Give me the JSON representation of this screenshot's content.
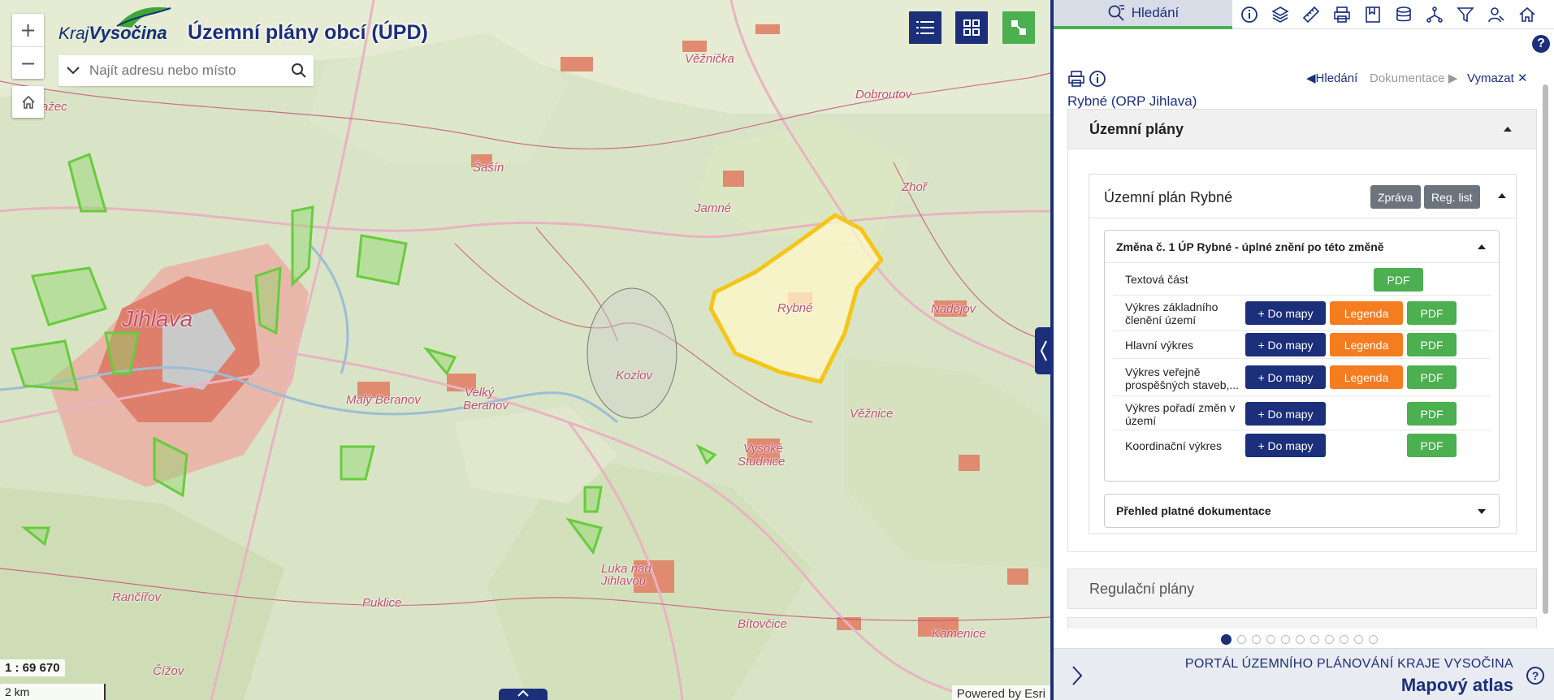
{
  "map": {
    "title": "Územní plány obcí (ÚPD)",
    "logo": {
      "kraj": "Kraj",
      "name": "Vysočina"
    },
    "search": {
      "placeholder": "Najít adresu nebo místo"
    },
    "zoom": {
      "in": "+",
      "out": "−"
    },
    "scale": "1 : 69 670",
    "scale_bar": "2 km",
    "attribution": "Powered by Esri",
    "labels": {
      "jihlava": "Jihlava",
      "rybne": "Rybné",
      "kozlov": "Kozlov",
      "maly_beranov": "Malý Beranov",
      "velky_beranov_1": "Velký",
      "velky_beranov_2": "Beranov",
      "jamne": "Jamné",
      "dobroutov": "Dobroutov",
      "nadejov": "Nadějov",
      "vezice": "Věžnice",
      "vysoke_studnice_1": "Vysoké",
      "vysoke_studnice_2": "Studnice",
      "zhor": "Zhoř",
      "rancirov": "Rančířov",
      "cizov": "Čížov",
      "bitovcice": "Bítovčice",
      "kamenice": "Kamenice",
      "pukov": "Puklice",
      "luka_1": "Luka nad",
      "luka_2": "Jihlavou",
      "vezicka": "Věžnička",
      "sasin": "Šašín",
      "pravlec": "Pražec"
    },
    "colors": {
      "boundary": "#f5c518",
      "brand": "#1b2f7a",
      "accent_green": "#4caf50"
    }
  },
  "panel": {
    "search_tab": "Hledání",
    "nav": {
      "back": "Hledání",
      "forward": "Dokumentace",
      "clear": "Vymazat"
    },
    "crumb": "Rybné (ORP Jihlava)",
    "sections": {
      "uzemni": "Územní plány",
      "regulacni": "Regulační plány"
    },
    "plan": {
      "title": "Územní plán Rybné",
      "btn_report": "Zpráva",
      "btn_reg": "Reg. list",
      "change_title": "Změna č. 1 ÚP Rybné - úplné znění po této změně",
      "overview_title": "Přehled platné dokumentace",
      "rows": [
        {
          "name": "Textová část",
          "pdf": "PDF"
        },
        {
          "name": "Výkres základního členění území",
          "map": "+ Do mapy",
          "legend": "Legenda",
          "pdf": "PDF"
        },
        {
          "name": "Hlavní výkres",
          "map": "+ Do mapy",
          "legend": "Legenda",
          "pdf": "PDF"
        },
        {
          "name": "Výkres veřejně prospěšných staveb,...",
          "map": "+ Do mapy",
          "legend": "Legenda",
          "pdf": "PDF"
        },
        {
          "name": "Výkres pořadí změn v území",
          "map": "+ Do mapy",
          "pdf": "PDF"
        },
        {
          "name": "Koordinační výkres",
          "map": "+ Do mapy",
          "pdf": "PDF"
        }
      ]
    },
    "pagination": {
      "total": 11,
      "active": 1
    },
    "footer": {
      "portal": "PORTÁL ÚZEMNÍHO PLÁNOVÁNÍ KRAJE VYSOČINA",
      "atlas": "Mapový atlas",
      "help": "?"
    }
  }
}
